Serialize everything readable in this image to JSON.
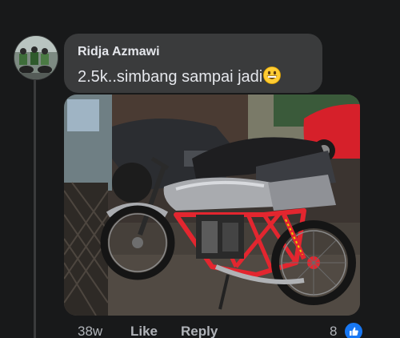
{
  "comment": {
    "author": "Ridja Azmawi",
    "text": "2.5k..simbang sampai jadi",
    "emoji": "grinning-face-icon"
  },
  "actions": {
    "time": "38w",
    "like": "Like",
    "reply": "Reply"
  },
  "reactions": {
    "count": "8",
    "type": "like-icon"
  },
  "colors": {
    "background": "#18191a",
    "bubble": "#3a3b3c",
    "text": "#e4e6eb",
    "secondary_text": "#b0b3b8",
    "like_blue": "#1877f2"
  }
}
